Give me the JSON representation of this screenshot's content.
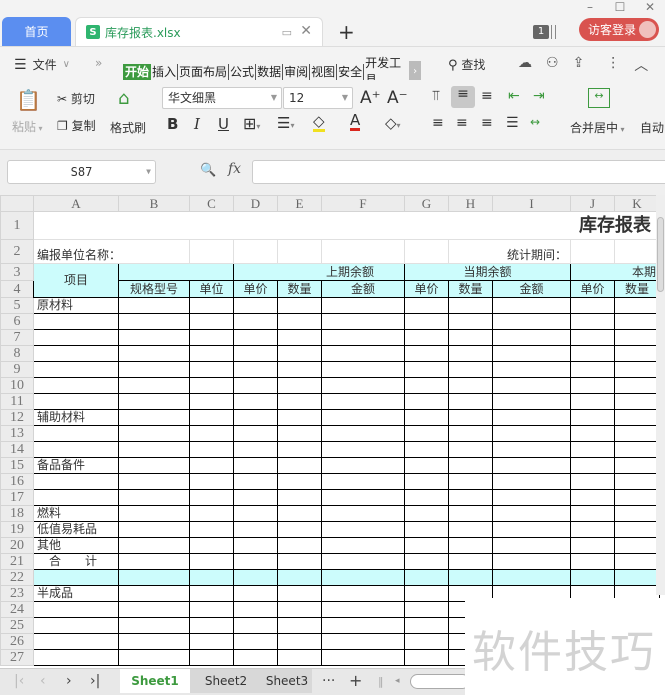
{
  "titlebar": {
    "home_tab": "首页",
    "file_tab": "库存报表.xlsx",
    "file_icon": "S",
    "new_tab": "+",
    "window_badge": "1",
    "login_label": "访客登录"
  },
  "menubar": {
    "file_menu": "文件",
    "tabs": [
      {
        "label": "开始",
        "active": true
      },
      {
        "label": "插入"
      },
      {
        "label": "页面布局"
      },
      {
        "label": "公式"
      },
      {
        "label": "数据"
      },
      {
        "label": "审阅"
      },
      {
        "label": "视图"
      },
      {
        "label": "安全"
      },
      {
        "label": "开发工具"
      }
    ],
    "find_label": "查找"
  },
  "ribbon": {
    "paste": "粘贴",
    "cut": "剪切",
    "copy": "复制",
    "format_painter": "格式刷",
    "font_name": "华文细黑",
    "font_size": "12",
    "bold": "B",
    "italic": "I",
    "underline": "U",
    "merge_center": "合并居中",
    "auto_wrap": "自动"
  },
  "formula_bar": {
    "name_box": "S87",
    "fx_label": "fx",
    "formula": ""
  },
  "grid": {
    "columns": [
      "A",
      "B",
      "C",
      "D",
      "E",
      "F",
      "G",
      "H",
      "I",
      "J",
      "K"
    ],
    "title": "库存报表",
    "unit_label": "编报单位名称：",
    "period_label": "统计期间：",
    "header_item": "项目",
    "group_prev": "上期余额",
    "group_curr": "当期余额",
    "group_this": "本期",
    "sub_spec": "规格型号",
    "sub_unit": "单位",
    "sub_price": "单价",
    "sub_qty": "数量",
    "sub_amount": "金额",
    "rows": {
      "5": "原材料",
      "12": "辅助材料",
      "15": "备品备件",
      "18": "燃料",
      "19": "低值易耗品",
      "20": "其他",
      "21": "　合　　计",
      "23": "半成品"
    }
  },
  "sheets": {
    "tabs": [
      "Sheet1",
      "Sheet2",
      "Sheet3"
    ],
    "active": "Sheet1",
    "more": "···",
    "add": "+"
  },
  "watermark": "软件技巧"
}
